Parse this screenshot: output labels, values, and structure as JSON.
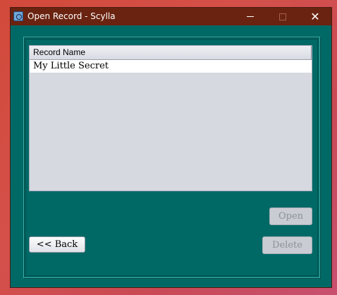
{
  "window": {
    "title": "Open Record - Scylla",
    "minimize_label": "",
    "maximize_label": "",
    "close_label": "✕"
  },
  "table": {
    "columns": [
      "Record Name"
    ],
    "rows": [
      {
        "record_name": "My Little Secret"
      }
    ]
  },
  "buttons": {
    "open": "Open",
    "back": "<< Back",
    "delete": "Delete"
  }
}
